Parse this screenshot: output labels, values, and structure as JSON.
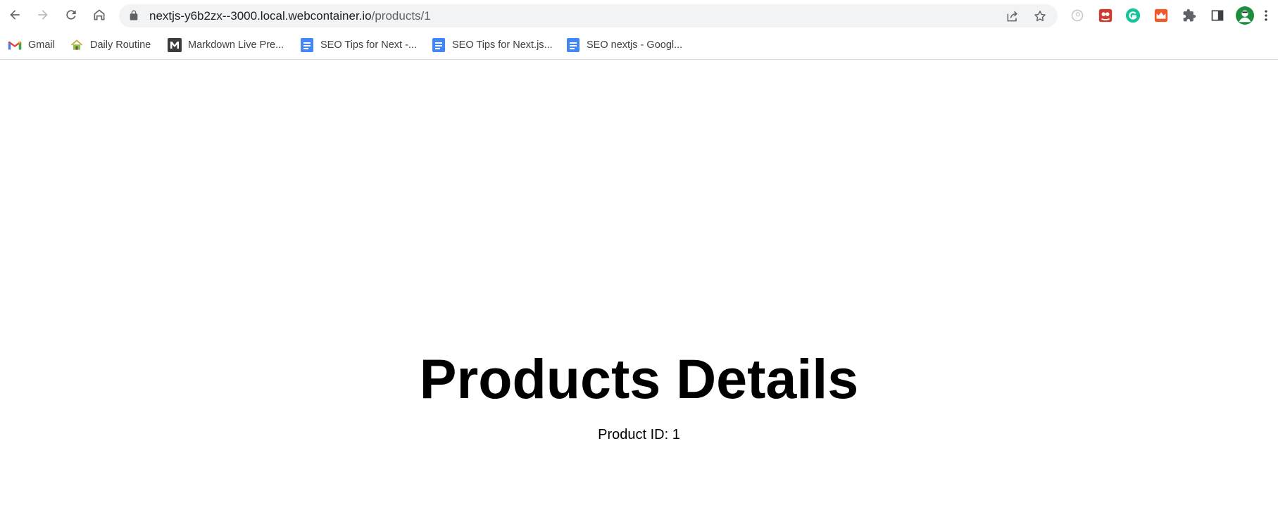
{
  "browser": {
    "url_host": "nextjs-y6b2zx--3000.local.webcontainer.io",
    "url_path": "/products/1"
  },
  "bookmarks": [
    {
      "label": "Gmail",
      "icon": "gmail-icon"
    },
    {
      "label": "Daily Routine",
      "icon": "house-icon"
    },
    {
      "label": "Markdown Live Pre...",
      "icon": "markdown-icon"
    },
    {
      "label": "SEO Tips for Next -...",
      "icon": "google-docs-icon"
    },
    {
      "label": "SEO Tips for Next.js...",
      "icon": "google-docs-icon"
    },
    {
      "label": "SEO nextjs - Googl...",
      "icon": "google-docs-icon"
    }
  ],
  "page": {
    "title": "Products Details",
    "product_id_text": "Product ID: 1"
  },
  "colors": {
    "omnibox_bg": "#f1f3f4",
    "docs_blue": "#4285f4",
    "grammarly_green": "#15c39a"
  }
}
